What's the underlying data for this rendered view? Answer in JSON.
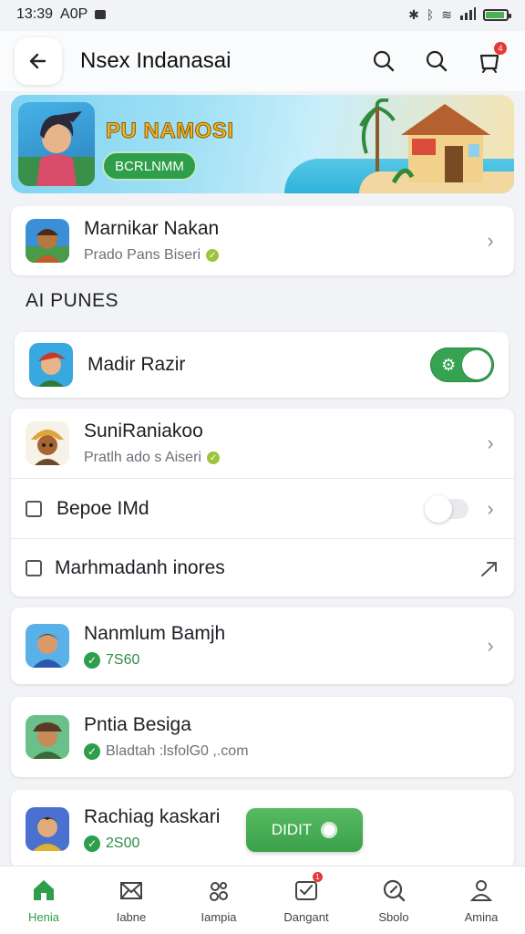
{
  "status_bar": {
    "time": "13:39",
    "carrier": "A0P",
    "icons": [
      "nfc-icon",
      "bluetooth-icon",
      "wifi-icon",
      "signal-icon",
      "battery-icon"
    ],
    "battery_level": 0.9
  },
  "app_bar": {
    "title": "Nsex Indanasai",
    "actions": [
      "search-icon",
      "search-icon",
      "notification-icon"
    ],
    "notification_badge": "4"
  },
  "banner": {
    "title": "PU NAMOSI",
    "button_label": "BCRLNMM"
  },
  "list1": {
    "title": "Marnikar Nakan",
    "subtitle": "Prado Pans Biseri"
  },
  "section_header": "AI PUNES",
  "toggle_row": {
    "title": "Madir Razir",
    "toggle_on": true
  },
  "list2": [
    {
      "kind": "avatar",
      "title": "SuniRaniakoo",
      "subtitle": "Pratlh ado s Aiseri"
    },
    {
      "kind": "checkbox",
      "title": "Bepoe IMd",
      "toggle_on": false
    },
    {
      "kind": "checkbox",
      "title": "Marhmadanh inores"
    }
  ],
  "card_nanmlum": {
    "title": "Nanmlum Bamjh",
    "subtitle": "7S60"
  },
  "card_pntia": {
    "title": "Pntia Besiga",
    "subtitle": "Bladtah :lsfolG0 ,.com"
  },
  "card_rachiag": {
    "title": "Rachiag kaskari",
    "subtitle": "2S00",
    "button_label": "DIDIT"
  },
  "bottom_nav": [
    {
      "label": "Henia",
      "icon": "home-icon",
      "active": true
    },
    {
      "label": "Iabne",
      "icon": "mail-icon"
    },
    {
      "label": "Iampia",
      "icon": "people-icon"
    },
    {
      "label": "Dangant",
      "icon": "inbox-icon",
      "badge": "1"
    },
    {
      "label": "Sbolo",
      "icon": "search-icon"
    },
    {
      "label": "Amina",
      "icon": "profile-icon"
    }
  ],
  "colors": {
    "accent_green": "#2e9e4a",
    "badge_red": "#e53935",
    "background": "#f1f3f6"
  }
}
